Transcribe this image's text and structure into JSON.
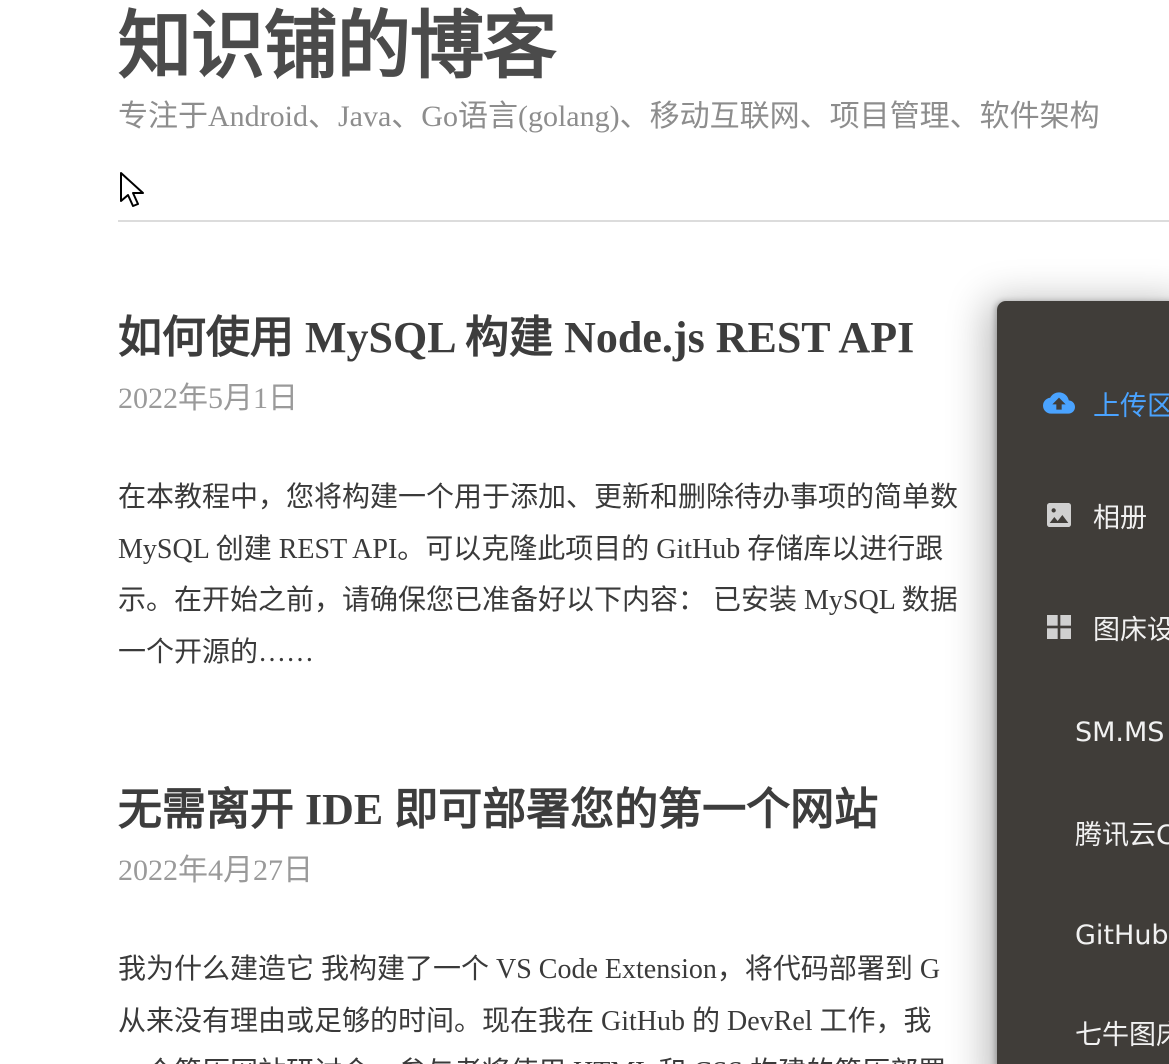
{
  "site": {
    "title": "知识铺的博客",
    "description": "专注于Android、Java、Go语言(golang)、移动互联网、项目管理、软件架构"
  },
  "posts": [
    {
      "title": "如何使用 MySQL 构建 Node.js REST API",
      "date": "2022年5月1日",
      "excerpt_lines": [
        "在本教程中，您将构建一个用于添加、更新和删除待办事项的简单数",
        "MySQL 创建 REST API。可以克隆此项目的 GitHub 存储库以进行跟",
        "示。在开始之前，请确保您已准备好以下内容： 已安装 MySQL 数据",
        "一个开源的……"
      ]
    },
    {
      "title": "无需离开 IDE 即可部署您的第一个网站",
      "date": "2022年4月27日",
      "excerpt_lines": [
        "我为什么建造它 我构建了一个 VS Code Extension，将代码部署到 G",
        "从来没有理由或足够的时间。现在我在 GitHub 的 DevRel 工作，我",
        "一个简历网站研讨会，参与者将使用 HTML 和 CSS 构建的简历部署"
      ]
    }
  ],
  "panel": {
    "items": [
      {
        "label": "上传区",
        "icon": "cloud-upload-icon",
        "active": true
      },
      {
        "label": "相册",
        "icon": "image-icon",
        "active": false
      },
      {
        "label": "图床设置",
        "icon": "grid-icon",
        "active": false
      }
    ],
    "subitems": [
      "SM.MS",
      "腾讯云COS",
      "GitHub图床",
      "七牛图床"
    ],
    "colors": {
      "background": "#403d39",
      "active": "#4aa3ff",
      "text": "#f1f1f1"
    }
  }
}
